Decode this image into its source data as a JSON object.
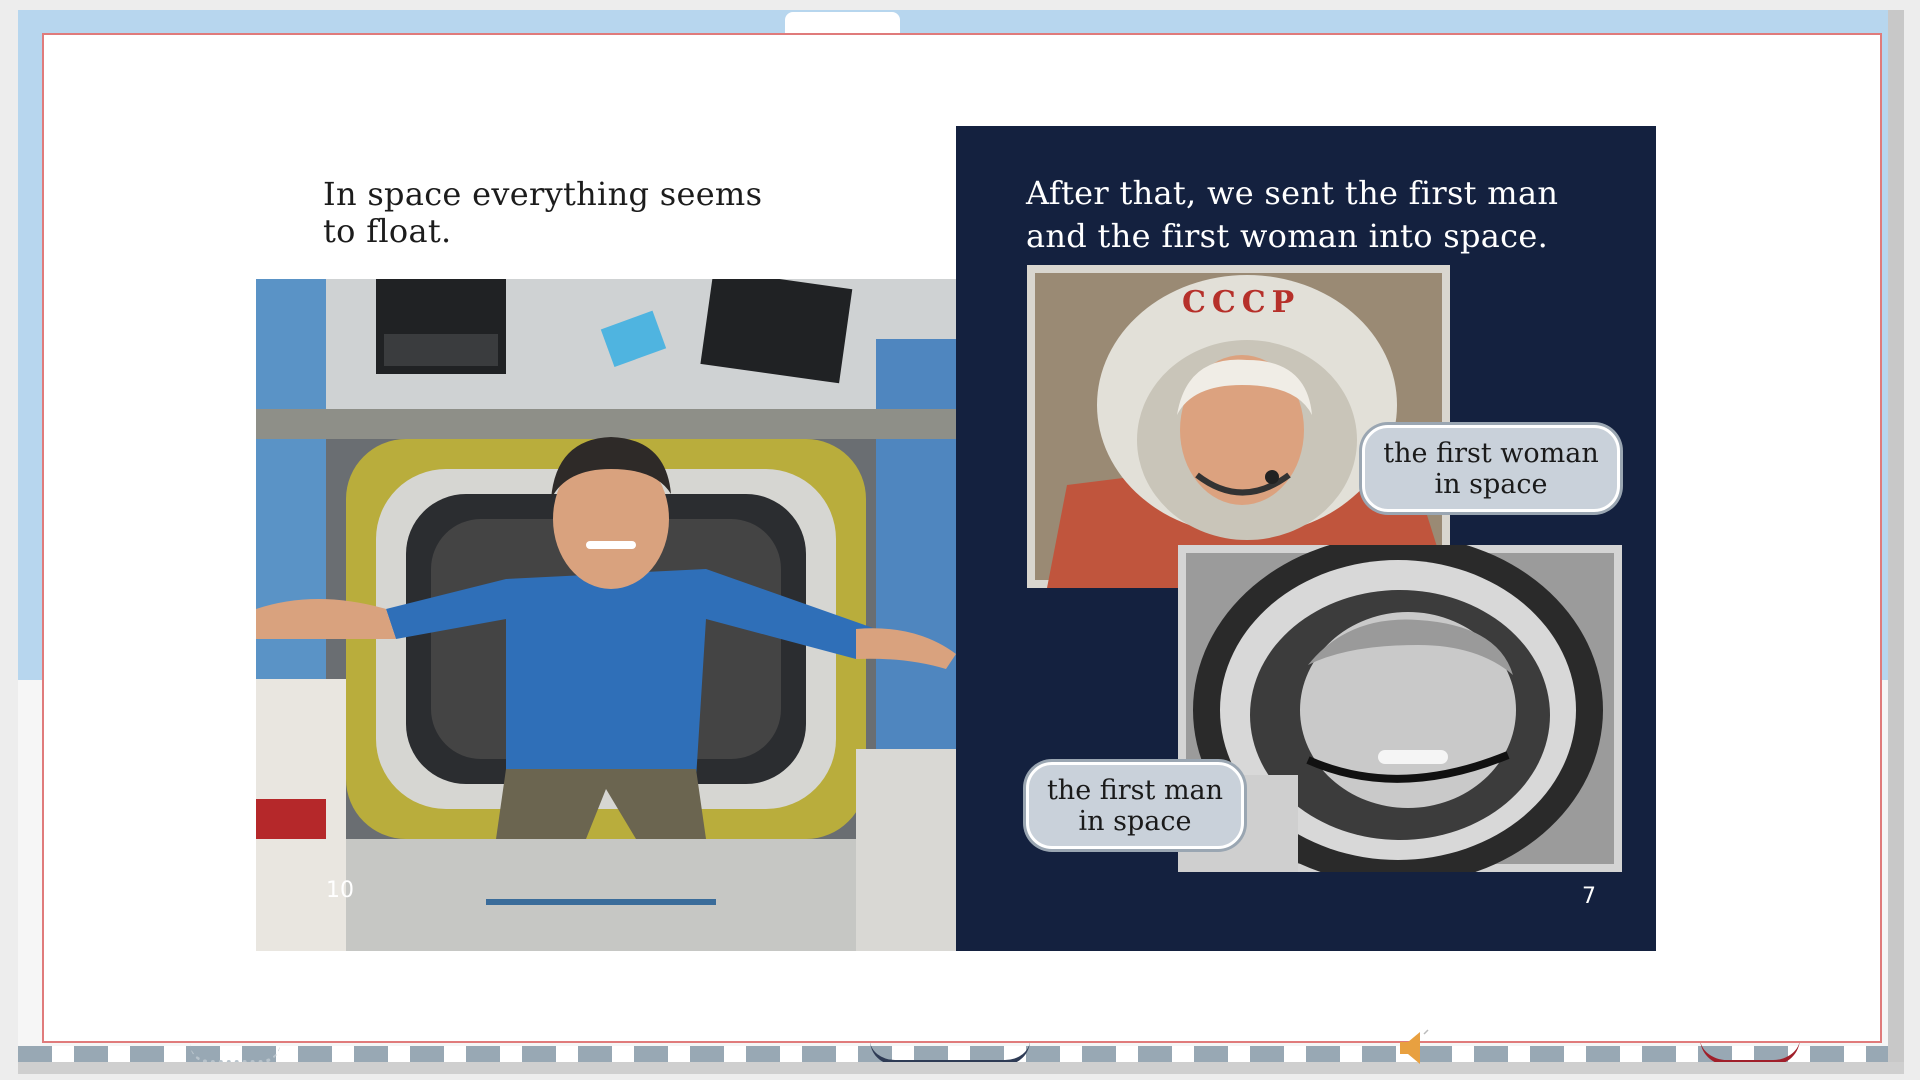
{
  "left_page": {
    "caption_line1": "In space everything seems",
    "caption_line2": "to float.",
    "page_number": "10"
  },
  "right_page": {
    "caption_line1": "After that, we sent the first man",
    "caption_line2": "and the first woman into space.",
    "helmet_text": "CCCP",
    "woman_label_line1": "the first woman",
    "woman_label_line2": "in space",
    "man_label_line1": "the first man",
    "man_label_line2": "in space",
    "page_number": "7"
  },
  "colors": {
    "right_page_bg": "#14213f",
    "slide_border": "#e07b7b",
    "bubble_fill": "#c9d1da"
  },
  "icons": {
    "audio": "speaker-icon"
  }
}
